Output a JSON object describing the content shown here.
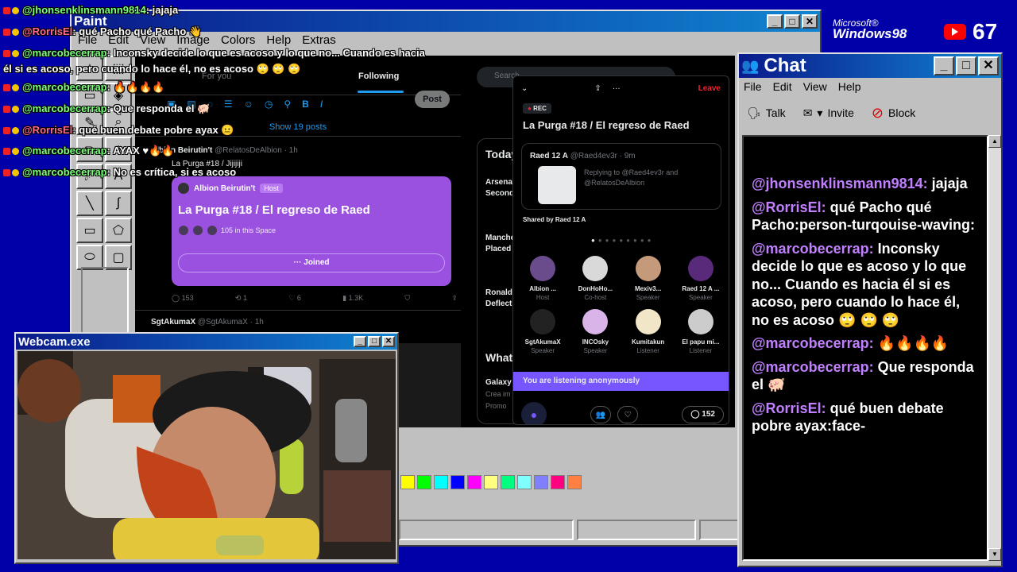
{
  "desktop": {
    "windows98_badge": {
      "microsoft": "Microsoft®",
      "windows": "Windows98"
    },
    "viewer_count": "67"
  },
  "paint": {
    "title": "Paint",
    "menu": [
      "File",
      "Edit",
      "View",
      "Image",
      "Colors",
      "Help",
      "Extras"
    ],
    "palette": [
      "#ffff00",
      "#00ff00",
      "#00ffff",
      "#0000ff",
      "#ff00ff",
      "#ffff80",
      "#00ff80",
      "#80ffff",
      "#8080ff",
      "#ff0080",
      "#ff8040"
    ]
  },
  "twitter": {
    "tab_for_you": "For you",
    "tab_following": "Following",
    "post_button": "Post",
    "show_posts": "Show 19 posts",
    "post1": {
      "author": "Albion Beirutin't",
      "handle": "@RelatosDeAlbion · 1h",
      "text": "La Purga #18 / Jijijiji",
      "space_host": "Albion Beirutin't",
      "host_badge": "Host",
      "space_title": "La Purga #18 / El regreso de Raed",
      "space_listeners": "105 in this Space",
      "joined": "Joined",
      "replies": "153",
      "reposts": "1",
      "likes": "6",
      "views": "1.3K"
    },
    "post2": {
      "author": "SgtAkumaX",
      "handle": "@SgtAkumaX · 1h"
    },
    "search_placeholder": "Search",
    "trends_title": "Today",
    "trends": [
      "Arsena",
      "Second",
      "Manche",
      "Placed",
      "Ronaldo",
      "Deflect"
    ],
    "whats_title": "What",
    "whats_items": [
      "Galaxy",
      "Crea im",
      "Promo"
    ]
  },
  "space": {
    "leave": "Leave",
    "rec": "REC",
    "title": "La Purga #18 / El regreso de Raed",
    "card_author": "Raed 12 A",
    "card_handle": "@Raed4ev3r · 9m",
    "card_reply": "Replying to @Raed4ev3r and @RelatosDeAlbion",
    "shared_by": "Shared by Raed 12 A",
    "speakers": [
      {
        "name": "Albion ...",
        "role": "Host",
        "color": "#6a4c8c"
      },
      {
        "name": "DonHoHo...",
        "role": "Co-host",
        "color": "#d9d9d9"
      },
      {
        "name": "Mexiv3...",
        "role": "Speaker",
        "color": "#c49a7a"
      },
      {
        "name": "Raed 12 A ...",
        "role": "Speaker",
        "color": "#5a2a7a"
      },
      {
        "name": "SgtAkumaX",
        "role": "Speaker",
        "color": "#222222"
      },
      {
        "name": "INCOsky",
        "role": "Speaker",
        "color": "#d8b4e8"
      },
      {
        "name": "Kumitakun",
        "role": "Listener",
        "color": "#f2e6c8"
      },
      {
        "name": "El papu mi...",
        "role": "Listener",
        "color": "#cccccc"
      }
    ],
    "anon_bar": "You are listening anonymously",
    "comment_count": "152"
  },
  "webcam": {
    "title": "Webcam.exe"
  },
  "chat": {
    "title": "Chat",
    "menu": [
      "File",
      "Edit",
      "View",
      "Help"
    ],
    "toolbar": {
      "talk": "Talk",
      "invite": "Invite",
      "block": "Block"
    },
    "messages": [
      {
        "user": "@jhonsenklinsmann9814:",
        "text": " jajaja"
      },
      {
        "user": "@RorrisEl:",
        "text": " qué Pacho qué Pacho:person-turqouise-waving:"
      },
      {
        "user": "@marcobecerrap:",
        "text": " Inconsky decide lo que es acoso y lo que no... Cuando es hacia él si es acoso, pero cuando lo hace él, no es acoso 🙄 🙄 🙄"
      },
      {
        "user": "@marcobecerrap:",
        "text": " 🔥🔥🔥🔥"
      },
      {
        "user": "@marcobecerrap:",
        "text": " Que responda el 🐖"
      },
      {
        "user": "@RorrisEl:",
        "text": " qué buen debate pobre ayax:face-"
      }
    ]
  },
  "overlay_chat": [
    {
      "user": "@jhonsenklinsmann9814",
      "text": ": jajaja"
    },
    {
      "user": "@RorrisEl",
      "text": ": qué Pacho qué Pacho 👋"
    },
    {
      "user": "@marcobecerrap",
      "text": ": Inconsky decide lo que es acoso y lo que no... Cuando es hacia él si es acoso, pero cuando lo hace él, no es acoso 🙄 🙄 🙄"
    },
    {
      "user": "@marcobecerrap",
      "text": ": 🔥🔥🔥🔥"
    },
    {
      "user": "@marcobecerrap",
      "text": ": Que responda el 🐖"
    },
    {
      "user": "@RorrisEl",
      "text": ": qué buen debate pobre ayax 😐"
    },
    {
      "user": "@marcobecerrap",
      "text": ": AYAX ♥🔥🔥"
    },
    {
      "user": "@marcobecerrap",
      "text": ": No es crítica, si es acoso"
    }
  ]
}
